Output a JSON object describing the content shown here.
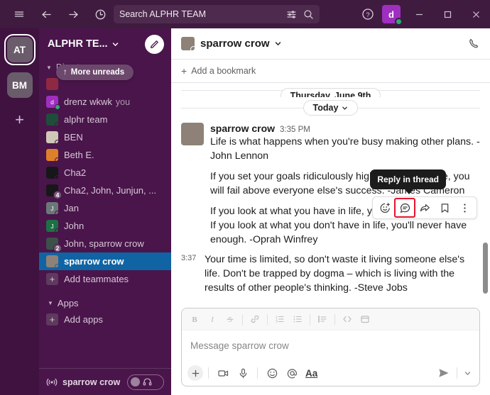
{
  "topbar": {
    "menu_icon": "hamburger-icon",
    "back_icon": "arrow-left-icon",
    "forward_icon": "arrow-right-icon",
    "history_icon": "clock-icon",
    "search": {
      "value": "Search ALPHR TEAM",
      "filter_icon": "filters-icon",
      "search_icon": "search-icon"
    },
    "help_icon": "question-circle-icon",
    "user_avatar_letter": "d",
    "minimize_label": "–",
    "maximize_label": "□",
    "close_label": "✕"
  },
  "rail": {
    "workspaces": [
      {
        "initials": "AT",
        "active": true
      },
      {
        "initials": "BM",
        "active": false
      }
    ],
    "add_label": "+"
  },
  "sidebar": {
    "workspace_name": "ALPHR TE...",
    "compose_icon": "compose-icon",
    "more_unreads": {
      "label": "More unreads",
      "arrow": "↑"
    },
    "dm_section_label": "Direct messages",
    "items": [
      {
        "name": "drenz wkwk",
        "suffix": "you",
        "avatar_color": "#9F2FBF",
        "avatar_letter": "d",
        "presence": "online"
      },
      {
        "name": "alphr team",
        "avatar_color": "#1F4D3C",
        "avatar_letter": "",
        "presence": "offline"
      },
      {
        "name": "BEN",
        "avatar_color": "#BFB8A8",
        "avatar_letter": "",
        "presence": "offline"
      },
      {
        "name": "Beth E.",
        "avatar_color": "#D9792B",
        "avatar_letter": "",
        "presence": "offline"
      },
      {
        "name": "Cha2",
        "avatar_color": "#17171A",
        "avatar_letter": "",
        "presence": "offline"
      },
      {
        "name": "Cha2, John, Junjun, ...",
        "avatar_color": "#17171A",
        "avatar_letter": "",
        "members": "4"
      },
      {
        "name": "Jan",
        "avatar_color": "#5C6B6B",
        "avatar_letter": "J",
        "presence": "offline"
      },
      {
        "name": "John",
        "avatar_color": "#1D7044",
        "avatar_letter": "J",
        "presence": "offline"
      },
      {
        "name": "John, sparrow crow",
        "avatar_color": "#3C5148",
        "avatar_letter": "",
        "members": "2"
      },
      {
        "name": "sparrow crow",
        "avatar_color": "#8E8278",
        "avatar_letter": "",
        "presence": "offline",
        "selected": true
      }
    ],
    "add_teammates_label": "Add teammates",
    "apps_section_label": "Apps",
    "add_apps_label": "Add apps",
    "huddle": {
      "icon": "broadcast-icon",
      "name": "sparrow crow",
      "headphones_icon": "headphones-icon"
    }
  },
  "channel": {
    "name": "sparrow crow",
    "caret_icon": "chevron-down-icon",
    "call_icon": "phone-icon",
    "bookmark_label": "Add a bookmark",
    "bookmark_plus": "+"
  },
  "messages": {
    "dividers": {
      "previous": "Thursday, June 9th",
      "today": "Today"
    },
    "items": [
      {
        "user": "sparrow crow",
        "time": "3:35 PM",
        "paragraphs": [
          "Life is what happens when you're busy making other plans. -John Lennon",
          "If you set your goals ridiculously high and it's a failure, you will fail above everyone else's success. -James Cameron",
          "If you look at what you have in life, you'll always have more. If you look at what you don't have in life, you'll never have enough. -Oprah Winfrey"
        ]
      },
      {
        "gutter_time": "3:37",
        "paragraphs": [
          "Your time is limited, so don't waste it living someone else's life. Don't be trapped by dogma – which is living with the results of other people's thinking. -Steve Jobs"
        ]
      }
    ]
  },
  "hover_actions": {
    "tooltip": "Reply in thread",
    "highlight_color": "#E8112D",
    "buttons": [
      {
        "icon": "add-reaction-icon",
        "highlighted": false
      },
      {
        "icon": "reply-in-thread-icon",
        "highlighted": true
      },
      {
        "icon": "share-message-icon",
        "highlighted": false
      },
      {
        "icon": "save-for-later-icon",
        "highlighted": false
      },
      {
        "icon": "more-actions-icon",
        "highlighted": false
      }
    ]
  },
  "composer": {
    "placeholder": "Message sparrow crow",
    "format_buttons": [
      "bold-icon",
      "italic-icon",
      "strikethrough-icon",
      "link-icon",
      "ordered-list-icon",
      "bulleted-list-icon",
      "blockquote-icon",
      "code-icon",
      "code-block-icon"
    ],
    "action_buttons": [
      "plus-icon",
      "video-icon",
      "microphone-icon",
      "emoji-icon",
      "mention-icon",
      "formatting-aa"
    ],
    "aa_label": "Aa",
    "send_icon": "send-icon",
    "send_options_icon": "chevron-down-icon"
  }
}
